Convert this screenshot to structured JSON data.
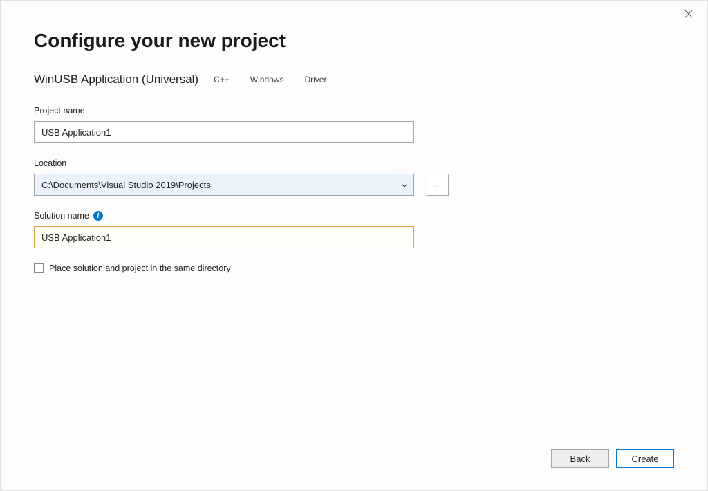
{
  "header": {
    "title": "Configure your new project"
  },
  "template": {
    "name": "WinUSB Application (Universal)",
    "tags": [
      "C++",
      "Windows",
      "Driver"
    ]
  },
  "fields": {
    "project_name": {
      "label": "Project name",
      "value": "USB Application1"
    },
    "location": {
      "label": "Location",
      "value": "C:\\Documents\\Visual Studio 2019\\Projects",
      "browse_label": "..."
    },
    "solution_name": {
      "label": "Solution name",
      "value": "USB Application1"
    },
    "same_directory": {
      "label": "Place solution and project in the same directory",
      "checked": false
    }
  },
  "footer": {
    "back_label": "Back",
    "create_label": "Create"
  }
}
